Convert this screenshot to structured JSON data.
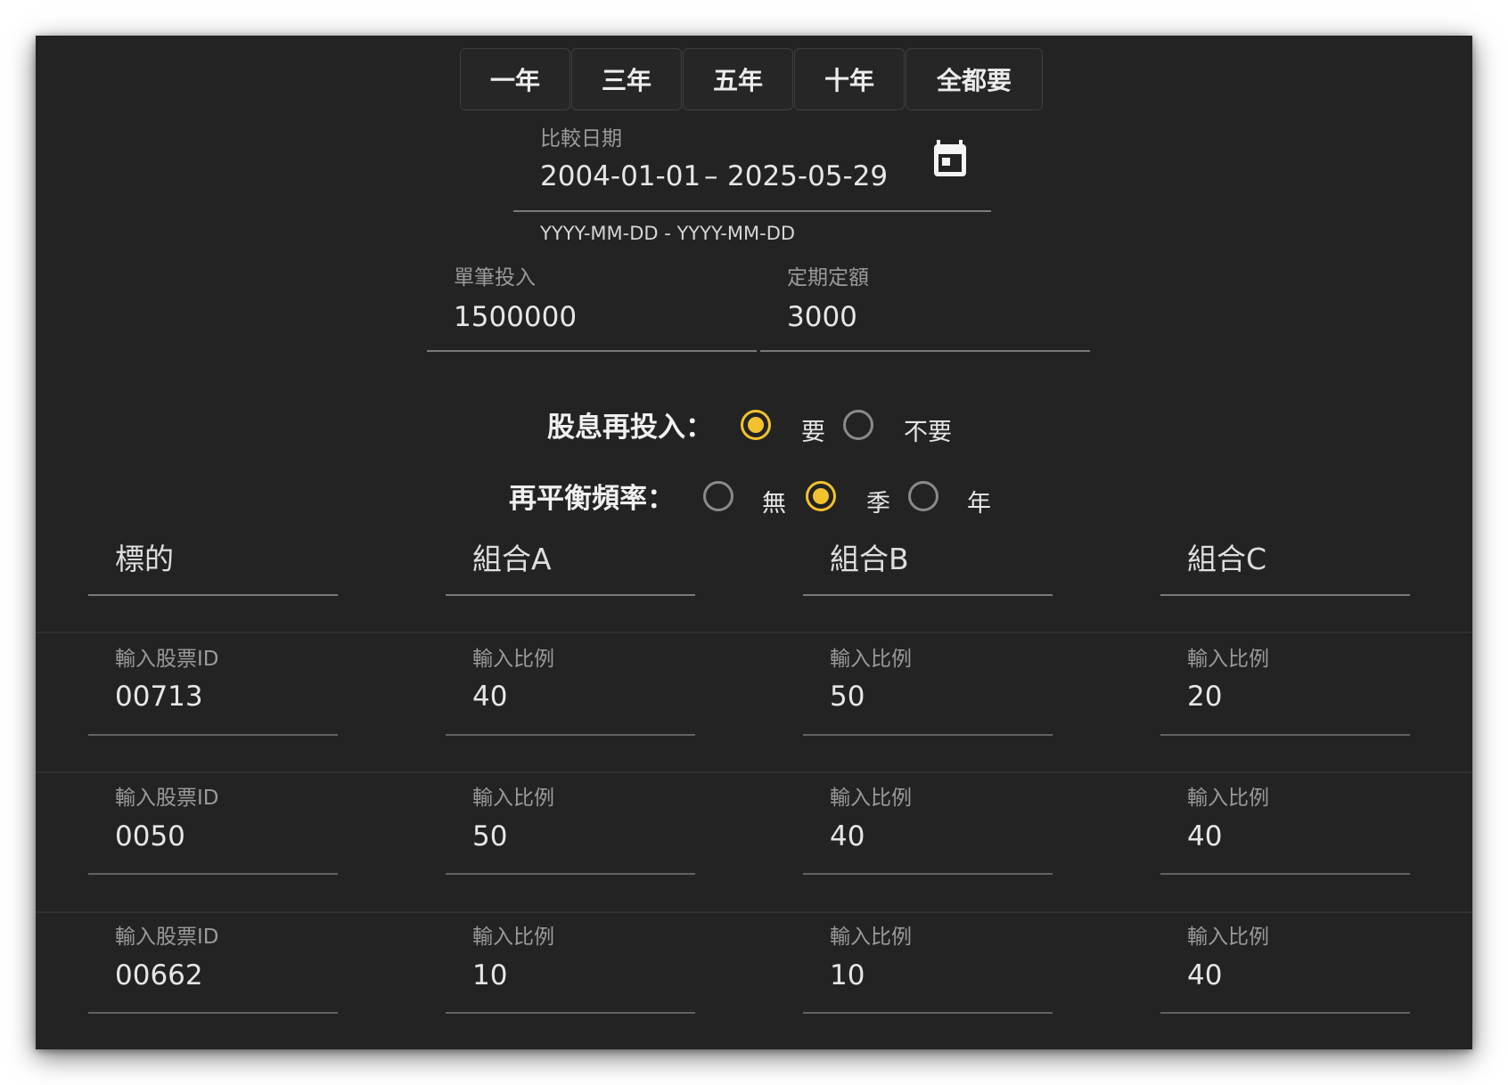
{
  "period_buttons": [
    "一年",
    "三年",
    "五年",
    "十年",
    "全都要"
  ],
  "date_range": {
    "label": "比較日期",
    "start": "2004-01-01",
    "separator": "–",
    "end": "2025-05-29",
    "hint": "YYYY-MM-DD - YYYY-MM-DD"
  },
  "lump_sum": {
    "label": "單筆投入",
    "value": "1500000"
  },
  "periodic": {
    "label": "定期定額",
    "value": "3000"
  },
  "dividend": {
    "label": "股息再投入：",
    "options": [
      "要",
      "不要"
    ],
    "selected": "要"
  },
  "rebalance": {
    "label": "再平衡頻率：",
    "options": [
      "無",
      "季",
      "年"
    ],
    "selected": "季"
  },
  "table": {
    "headers": [
      "標的",
      "組合A",
      "組合B",
      "組合C"
    ],
    "id_label": "輸入股票ID",
    "ratio_label": "輸入比例",
    "rows": [
      {
        "id": "00713",
        "a": "40",
        "b": "50",
        "c": "20"
      },
      {
        "id": "0050",
        "a": "50",
        "b": "40",
        "c": "40"
      },
      {
        "id": "00662",
        "a": "10",
        "b": "10",
        "c": "40"
      }
    ]
  },
  "colors": {
    "accent": "#f2c12e",
    "background": "#232323",
    "text": "#e6e6e6"
  }
}
